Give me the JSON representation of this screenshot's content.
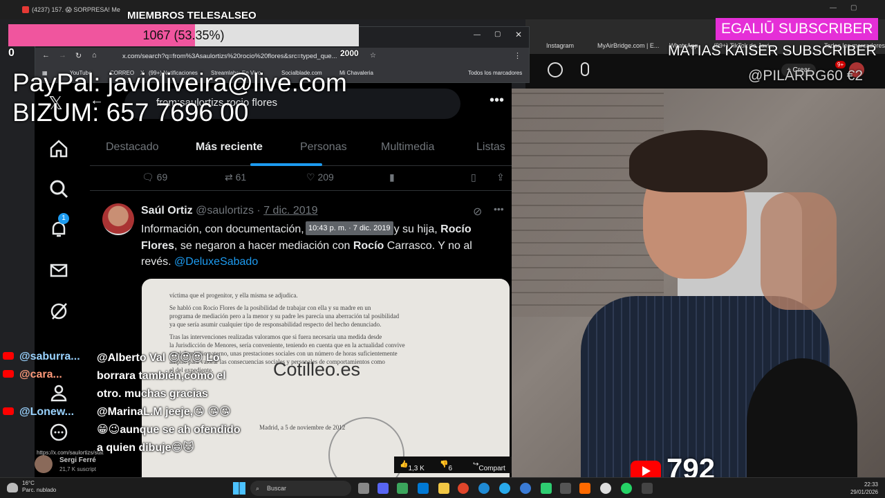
{
  "outer_browser": {
    "tabs": [
      "(4237) 157. 😱 SORPRESA! Me",
      "MIEMBROS TELESALSEO"
    ],
    "bookmarks": [
      "Instagram",
      "MyAirBridge.com | E...",
      "WhatsApp",
      "(99+) TikTok de Javi...",
      "Todos los marcadores"
    ],
    "yt_create_label": "Crear",
    "yt_notifications_badge": "9+"
  },
  "inner_browser": {
    "url": "x.com/search?q=from%3Asaulortizs%20rocio%20flores&src=typed_que...",
    "bookmarks": [
      "YouTube",
      "CORREO",
      "X",
      "(99+) Notificaciones",
      "Streamlabs: En Vivo",
      "Socialblade.com",
      "Mi Chavaleria",
      "Todos los marcadores"
    ]
  },
  "x_page": {
    "search_query": "from:saulortizs rocio flores",
    "nav_notification_badge": "1",
    "tabs": [
      "Destacado",
      "Más reciente",
      "Personas",
      "Multimedia",
      "Listas"
    ],
    "active_tab_index": 1,
    "prev_tweet_stats": {
      "replies": "69",
      "retweets": "61",
      "likes": "209"
    },
    "tweet": {
      "author_name": "Saúl Ortiz",
      "author_handle": "@saulortizs",
      "date": "7 dic. 2019",
      "tooltip": "10:43 p. m. · 7 dic. 2019",
      "text_parts": [
        {
          "t": "Información, con doc",
          "b": false
        },
        {
          "t": "umentación, de Antonio David y su hija, ",
          "b": false
        },
        {
          "t": "Rocío Flores",
          "b": true
        },
        {
          "t": ", se negaron a hacer mediación con ",
          "b": false
        },
        {
          "t": "Rocío",
          "b": true
        },
        {
          "t": " Carrasco. Y no al revés. ",
          "b": false
        }
      ],
      "mention": "@DeluxeSabado",
      "image_watermark": "Cotilleo.es",
      "image_doc_lines": [
        "víctima que el progenitor, y ella misma se adjudica.",
        "Se habló con Rocío Flores de la posibilidad de trabajar con ella y su madre en un",
        "programa de mediación pero a la menor y su padre les parecía una aberración tal posibilidad",
        "ya que sería asumir cualquier tipo de responsabilidad respecto del hecho denunciado.",
        "Tras las intervenciones realizadas valoramos que si fuera necesaria una medida desde",
        "la Jurisdicción de Menores, sería conveniente, teniendo en cuenta que en la actualidad convive",
        "en el domicilio paterno, unas prestaciones sociales con un número de horas suficientemente",
        "amplio para valorar las consecuencias sociales y personales de comportamientos como",
        "el del expediente."
      ],
      "image_doc_footer": "Madrid, a 5 de noviembre de 2012"
    }
  },
  "overlays": {
    "goal_title": "MIEMBROS TELESALSEO",
    "goal_text": "1067 (53.35%)",
    "goal_fraction": 0.5335,
    "goal_min": "0",
    "goal_max": "2000",
    "donate_line1": "PayPal: javioliveira@live.com",
    "donate_line2": "BIZUM: 657 7696 00",
    "sub_alert_1": "EGALIŪ  SUBSCRIBER",
    "sub_alert_2": "MATIAS KAISER  SUBSCRIBER",
    "tip_alert": "@PILARRG60  €2",
    "viewer_count": "792"
  },
  "chat": {
    "usernames": [
      "@saburra...",
      "@cara...",
      "@Lonew..."
    ],
    "message": "@Alberto Val 😍😍😍 Lo borrara también,como el otro. muchas gracias @MarinaL.M jeeje,😘 😘😘😁😉aunque se ah ofendido a quien dibuje😁🐱"
  },
  "video_meta": {
    "channel_name": "Sergi Ferré",
    "channel_subs": "21,7 K suscript",
    "status_url": "https://x.com/saulortizs/stat",
    "likes": "1,3 K",
    "dislikes": "6",
    "share_label": "Compart"
  },
  "taskbar": {
    "weather_temp": "16°C",
    "weather_desc": "Parc. nublado",
    "search_placeholder": "Buscar",
    "time": "22:33",
    "date": "29/01/2026"
  },
  "colors": {
    "x_blue": "#1d9bf0",
    "goal_pink": "#f0559e",
    "sub_alert_bg": "#e52fd7",
    "yt_red": "#ff0000"
  }
}
